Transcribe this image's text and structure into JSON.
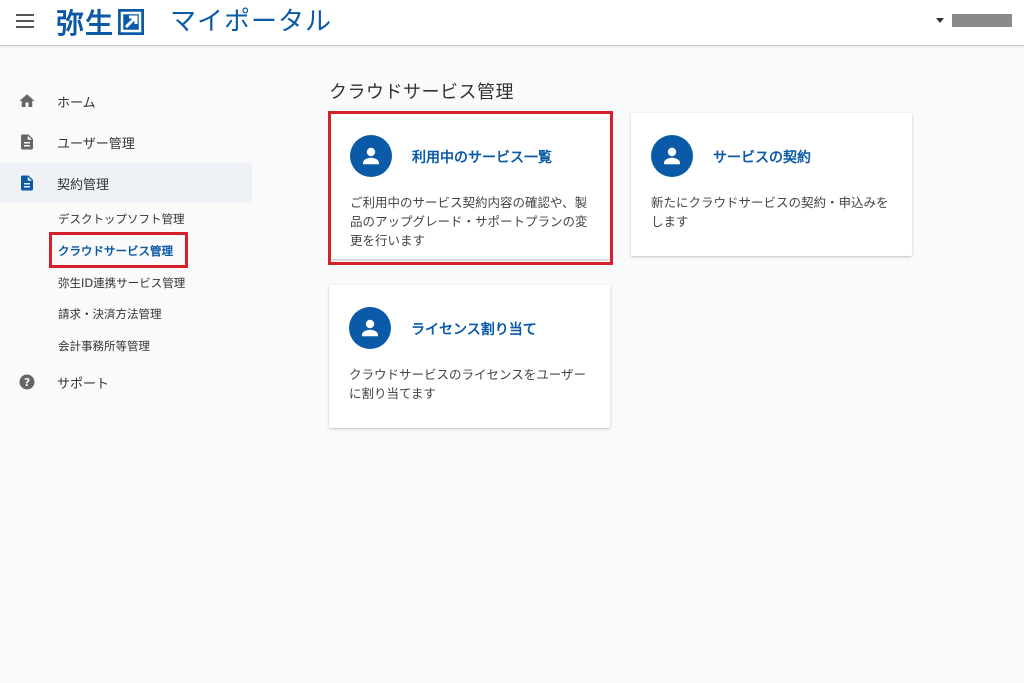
{
  "header": {
    "logo_text": "弥生",
    "portal_title": "マイポータル"
  },
  "sidebar": {
    "items": [
      {
        "label": "ホーム",
        "icon": "home-icon"
      },
      {
        "label": "ユーザー管理",
        "icon": "document-icon"
      },
      {
        "label": "契約管理",
        "icon": "document-icon"
      },
      {
        "label": "サポート",
        "icon": "help-icon"
      }
    ],
    "sub_items": [
      {
        "label": "デスクトップソフト管理"
      },
      {
        "label": "クラウドサービス管理"
      },
      {
        "label": "弥生ID連携サービス管理"
      },
      {
        "label": "請求・決済方法管理"
      },
      {
        "label": "会計事務所等管理"
      }
    ]
  },
  "main": {
    "page_title": "クラウドサービス管理",
    "cards": [
      {
        "title": "利用中のサービス一覧",
        "description": "ご利用中のサービス契約内容の確認や、製品のアップグレード・サポートプランの変更を行います",
        "icon": "person-icon"
      },
      {
        "title": "サービスの契約",
        "description": "新たにクラウドサービスの契約・申込みをします",
        "icon": "person-icon"
      },
      {
        "title": "ライセンス割り当て",
        "description": "クラウドサービスのライセンスをユーザーに割り当てます",
        "icon": "person-icon"
      }
    ]
  },
  "colors": {
    "brand": "#0b5aa8",
    "highlight": "#d6202a",
    "active_bg": "#eef1f5"
  }
}
